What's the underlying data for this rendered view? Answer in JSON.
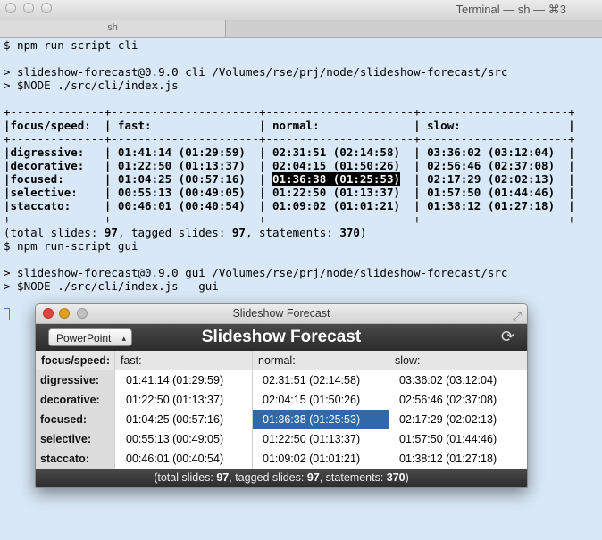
{
  "terminal": {
    "window_title": "Terminal — sh — ⌘3",
    "tab_label": "sh",
    "command1": "$ npm run-script cli",
    "log1": "> slideshow-forecast@0.9.0 cli /Volumes/rse/prj/node/slideshow-forecast/src",
    "log2": "> $NODE ./src/cli/index.js",
    "table_border": "+--------------+----------------------+----------------------+----------------------+",
    "table_header": "|focus/speed:  | fast:                | normal:              | slow:                |",
    "rows": [
      {
        "pre": "|digressive:   | 01:41:14 (01:29:59)  | 02:31:51 (02:14:58)  | 03:36:02 (03:12:04)  |"
      },
      {
        "pre": "|decorative:   | 01:22:50 (01:13:37)  | 02:04:15 (01:50:26)  | 02:56:46 (02:37:08)  |"
      },
      {
        "pre": "|focused:      | 01:04:25 (00:57:16)  | ",
        "hl": "01:36:38 (01:25:53)",
        "post": "  | 02:17:29 (02:02:13)  |"
      },
      {
        "pre": "|selective:    | 00:55:13 (00:49:05)  | 01:22:50 (01:13:37)  | 01:57:50 (01:44:46)  |"
      },
      {
        "pre": "|staccato:     | 00:46:01 (00:40:54)  | 01:09:02 (01:01:21)  | 01:38:12 (01:27:18)  |"
      }
    ],
    "summary": {
      "a": "(total slides: ",
      "total": "97",
      "b": ", tagged slides: ",
      "tagged": "97",
      "c": ", statements: ",
      "statements": "370",
      "d": ")"
    },
    "command2": "$ npm run-script gui",
    "log3": "> slideshow-forecast@0.9.0 gui /Volumes/rse/prj/node/slideshow-forecast/src",
    "log4": "> $NODE ./src/cli/index.js --gui"
  },
  "gui": {
    "window_title": "Slideshow Forecast",
    "heading": "Slideshow Forecast",
    "select_value": "PowerPoint",
    "columns": [
      "focus/speed:",
      "fast:",
      "normal:",
      "slow:"
    ],
    "rows": [
      {
        "label": "digressive:",
        "fast": "01:41:14 (01:29:59)",
        "normal": "02:31:51 (02:14:58)",
        "slow": "03:36:02 (03:12:04)"
      },
      {
        "label": "decorative:",
        "fast": "01:22:50 (01:13:37)",
        "normal": "02:04:15 (01:50:26)",
        "slow": "02:56:46 (02:37:08)"
      },
      {
        "label": "focused:",
        "fast": "01:04:25 (00:57:16)",
        "normal": "01:36:38 (01:25:53)",
        "slow": "02:17:29 (02:02:13)"
      },
      {
        "label": "selective:",
        "fast": "00:55:13 (00:49:05)",
        "normal": "01:22:50 (01:13:37)",
        "slow": "01:57:50 (01:44:46)"
      },
      {
        "label": "staccato:",
        "fast": "00:46:01 (00:40:54)",
        "normal": "01:09:02 (01:01:21)",
        "slow": "01:38:12 (01:27:18)"
      }
    ],
    "footer": {
      "a": "(total slides: ",
      "total": "97",
      "b": ", tagged slides: ",
      "tagged": "97",
      "c": ", statements: ",
      "statements": "370",
      "d": ")"
    },
    "selected_color": "#2f6aa6"
  }
}
